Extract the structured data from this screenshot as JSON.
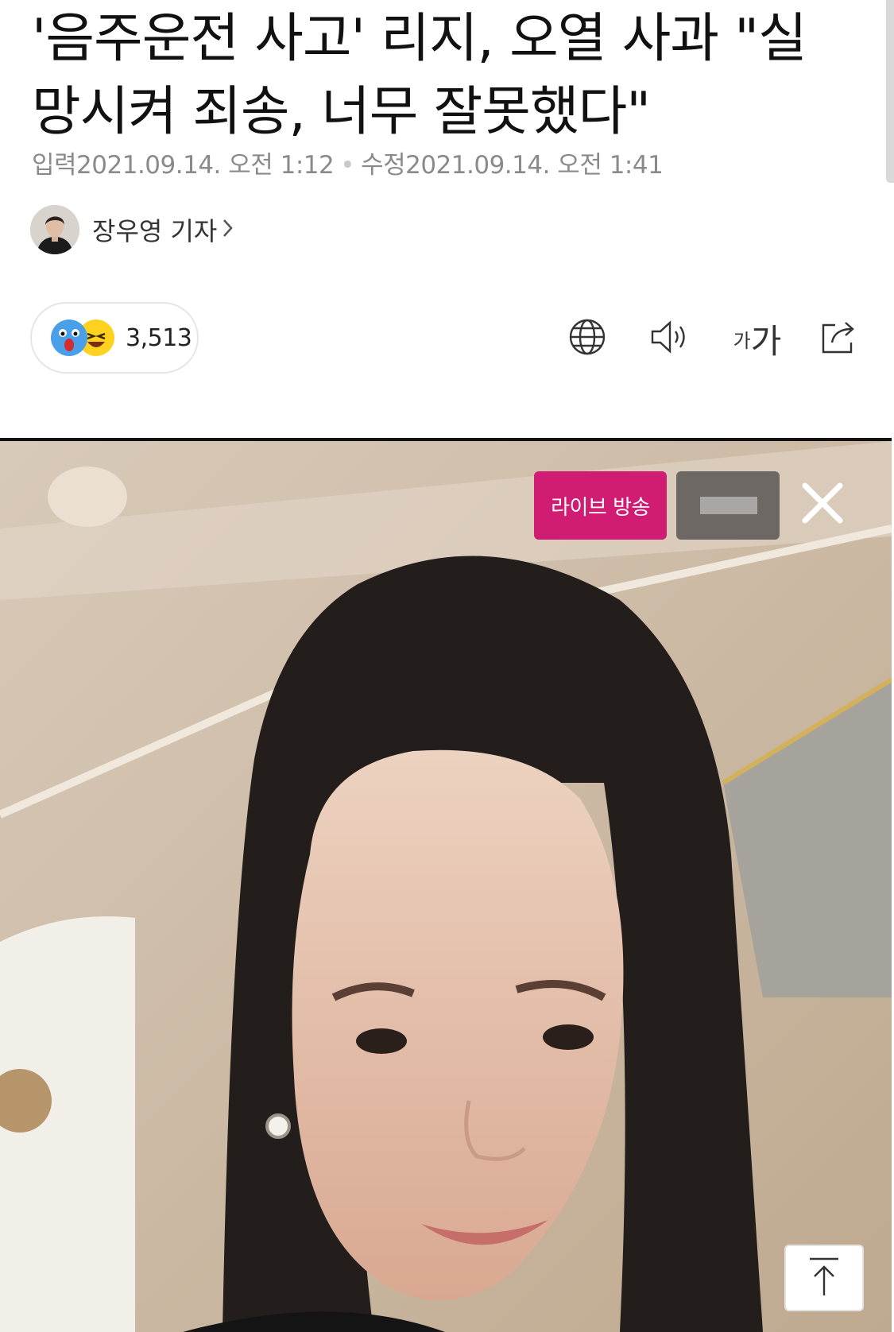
{
  "article": {
    "headline": "'음주운전 사고' 리지, 오열 사과 \"실망시켜 죄송, 너무 잘못했다\"",
    "input_label": "입력",
    "input_time": "2021.09.14. 오전 1:12",
    "modified_label": "수정",
    "modified_time": "2021.09.14. 오전 1:41",
    "author": "장우영 기자"
  },
  "reactions": {
    "count": "3,513",
    "emojis": [
      "surprised-face",
      "laughing-face"
    ]
  },
  "toolbar": {
    "icons": [
      "globe-icon",
      "speaker-icon",
      "font-size-icon",
      "share-icon"
    ],
    "font_small": "가",
    "font_large": "가"
  },
  "photo": {
    "live_badge": "라이브 방송"
  },
  "colors": {
    "live_badge": "#d01c72",
    "emoji_blue": "#4aa0e8",
    "emoji_yellow": "#ffd21f"
  }
}
